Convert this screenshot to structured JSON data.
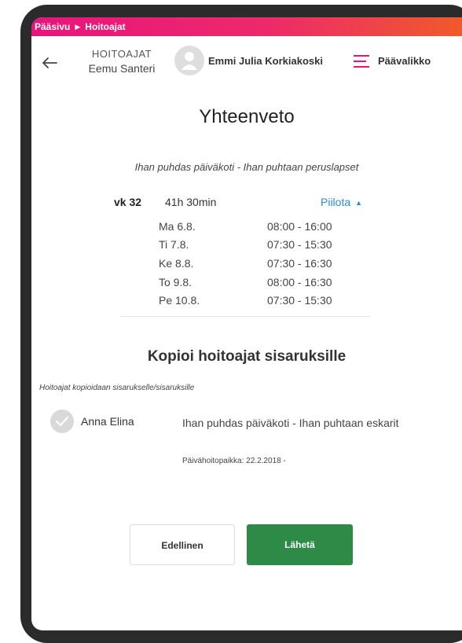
{
  "breadcrumb": {
    "home": "Pääsivu",
    "current": "Hoitoajat"
  },
  "header": {
    "child_role": "HOITOAJAT",
    "child_name": "Eemu Santeri",
    "avatar_initial": "",
    "user_name": "Emmi Julia Korkiakoski",
    "menu_label": "Päävalikko"
  },
  "summary": {
    "title": "Yhteenveto",
    "place": "Ihan puhdas päiväkoti - Ihan puhtaan peruslapset",
    "week": {
      "label": "vk 32",
      "total": "41h 30min",
      "toggle_label": "Piilota",
      "days": [
        {
          "day": "Ma 6.8.",
          "time": "08:00 - 16:00"
        },
        {
          "day": "Ti 7.8.",
          "time": "07:30 - 15:30"
        },
        {
          "day": "Ke 8.8.",
          "time": "07:30 - 16:30"
        },
        {
          "day": "To 9.8.",
          "time": "08:00 - 16:30"
        },
        {
          "day": "Pe 10.8.",
          "time": "07:30 - 15:30"
        }
      ]
    }
  },
  "copy_section": {
    "title": "Kopioi hoitoajat sisaruksille",
    "note": "Hoitoajat kopioidaan sisarukselle/sisaruksille",
    "siblings": [
      {
        "name": "Anna Elina",
        "place": "Ihan puhdas päiväkoti - Ihan puhtaan eskarit",
        "date": "Päivähoitopaikka: 22.2.2018 -"
      }
    ]
  },
  "actions": {
    "previous": "Edellinen",
    "send": "Lähetä"
  },
  "colors": {
    "accent_pink": "#e8147d",
    "accent_orange": "#f05a2a",
    "link_blue": "#2a8fd6",
    "send_green": "#2e8b47"
  }
}
